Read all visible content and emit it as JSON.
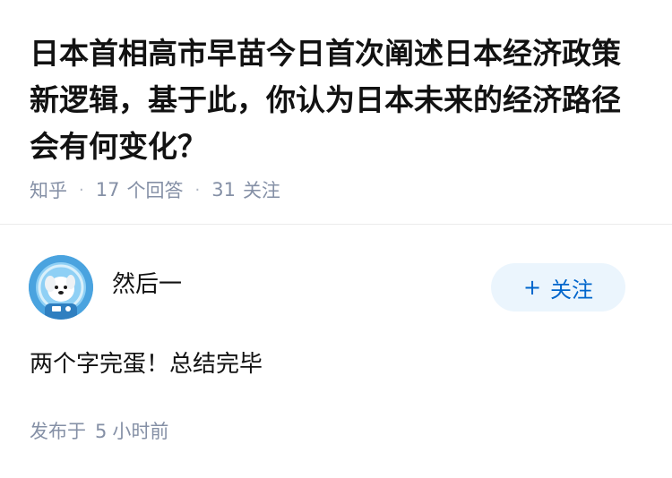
{
  "question": {
    "title": "日本首相高市早苗今日首次阐述日本经济政策新逻辑，基于此，你认为日本未来的经济路径会有何变化？",
    "source": "知乎",
    "answer_count": "17",
    "answer_label": "个回答",
    "follower_count": "31",
    "follower_label": "关注"
  },
  "answer": {
    "author_name": "然后一",
    "avatar_icon": "cartoon-dog-avatar-icon",
    "follow_button": {
      "plus": "+",
      "label": "关注"
    },
    "content": "两个字完蛋！总结完毕",
    "posted_prefix": "发布于",
    "posted_num": "5",
    "posted_suffix": "小时前"
  },
  "colors": {
    "title": "#121212",
    "meta": "#8590a6",
    "follow_bg": "#ebf5fd",
    "follow_text": "#0066cc",
    "avatar_bg": "#4aa3df"
  }
}
